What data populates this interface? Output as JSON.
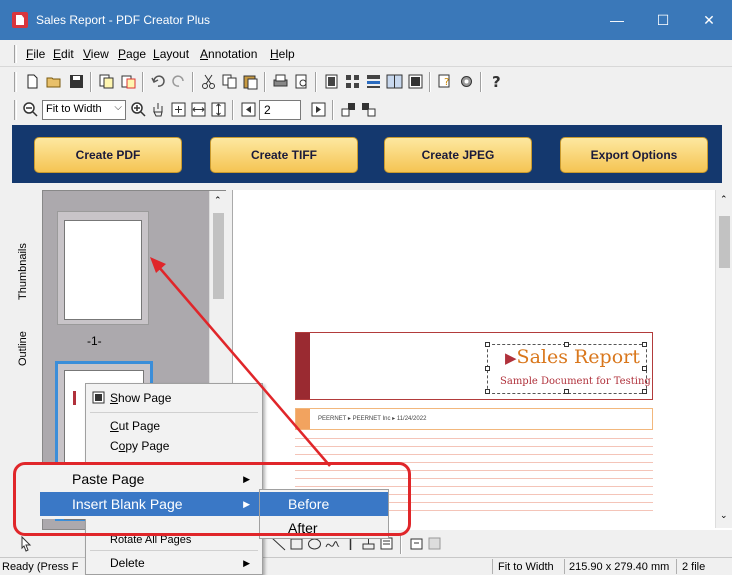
{
  "window": {
    "title": "Sales Report - PDF Creator Plus",
    "minimize": "—",
    "maximize": "☐",
    "close": "✕"
  },
  "menubar": {
    "items": [
      {
        "first": "F",
        "rest": "ile"
      },
      {
        "first": "E",
        "rest": "dit"
      },
      {
        "first": "V",
        "rest": "iew"
      },
      {
        "first": "P",
        "rest": "age"
      },
      {
        "first": "L",
        "rest": "ayout"
      },
      {
        "first": "A",
        "rest": "nnotation"
      },
      {
        "first": "H",
        "rest": "elp"
      }
    ]
  },
  "toolbar2": {
    "zoom_value": "Fit to Width",
    "page_number": "2"
  },
  "actions": {
    "create_pdf": "Create PDF",
    "create_tiff": "Create TIFF",
    "create_jpeg": "Create JPEG",
    "export_options": "Export Options"
  },
  "sidepanel": {
    "tab_thumbnails": "Thumbnails",
    "tab_outline": "Outline",
    "page1_label": "-1-"
  },
  "document": {
    "title": "Sales Report",
    "subtitle": "Sample Document for Testing",
    "strip_text": "PEERNET ▸ PEERNET Inc ▸ 11/24/2022"
  },
  "context_menu": {
    "show_page": {
      "first": "S",
      "rest": "how Page"
    },
    "cut_page": {
      "first": "C",
      "rest": "ut Page"
    },
    "copy_page": {
      "first": "o",
      "pre": "C",
      "rest": "py Page"
    },
    "rotate_all": "Rotate All Pages",
    "delete": "Delete",
    "paste_page": {
      "first": "P",
      "rest": "aste Page"
    },
    "insert_blank": {
      "first": "I",
      "rest": "nsert Blank Page"
    }
  },
  "submenu": {
    "before": {
      "first": "B",
      "rest": "efore"
    },
    "after": {
      "first": "A",
      "rest": "fter"
    }
  },
  "statusbar": {
    "ready": "Ready (Press F",
    "zoom": "Fit to Width",
    "page_size": "215.90 x 279.40 mm",
    "file_count": "2 file"
  },
  "colors": {
    "titlebar": "#3a78b9",
    "action_band": "#14386e",
    "highlight": "#3a78c6",
    "callout": "#e0262a",
    "doc_title": "#d9771c"
  }
}
